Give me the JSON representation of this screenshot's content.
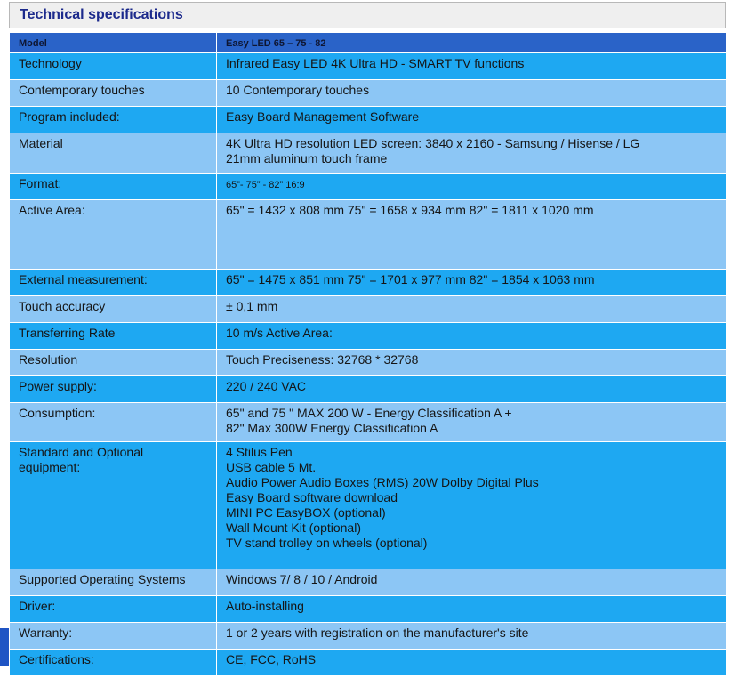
{
  "title": "Technical specifications",
  "header": {
    "label": "Model",
    "value": "Easy LED 65 – 75 - 82"
  },
  "rows": [
    {
      "label": "Technology",
      "value": "Infrared Easy LED 4K Ultra HD - SMART TV functions"
    },
    {
      "label": "Contemporary touches",
      "value": "10 Contemporary touches"
    },
    {
      "label": "Program included:",
      "value": "Easy Board Management Software"
    },
    {
      "label": "Material",
      "value": "4K Ultra HD resolution LED screen: 3840 x 2160 -  Samsung / Hisense / LG\n21mm aluminum touch frame"
    },
    {
      "label": "Format:",
      "value": "65”- 75” - 82”  16:9"
    },
    {
      "label": "Active Area:",
      "value": "65\" = 1432 x 808 mm     75\" = 1658 x 934 mm   82\" = 1811 x 1020 mm"
    },
    {
      "label": "External measurement:",
      "value": "65\" = 1475 x 851 mm     75\" = 1701 x 977 mm   82\" = 1854 x 1063 mm"
    },
    {
      "label": "Touch accuracy",
      "value": "± 0,1 mm"
    },
    {
      "label": "Transferring Rate",
      "value": "10 m/s Active Area:"
    },
    {
      "label": "Resolution",
      "value": "Touch Preciseness: 32768 * 32768"
    },
    {
      "label": "Power supply:",
      "value": "220 / 240 VAC"
    },
    {
      "label": "Consumption:",
      "value": "65\" and 75 \" MAX 200 W - Energy Classification A +\n82\" Max 300W   Energy Classification A"
    },
    {
      "label": "Standard and Optional\nequipment:",
      "value": "4 Stilus Pen\nUSB cable 5 Mt.\nAudio Power Audio Boxes (RMS) 20W Dolby Digital Plus\nEasy Board software download\nMINI PC EasyBOX (optional)\nWall Mount Kit (optional)\nTV stand trolley on wheels (optional)"
    },
    {
      "label": "Supported Operating Systems",
      "value": "Windows 7/  8 / 10 / Android"
    },
    {
      "label": "Driver:",
      "value": "Auto-installing"
    },
    {
      "label": "Warranty:",
      "value": "1 or 2 years with registration on the manufacturer's site"
    },
    {
      "label": "Certifications:",
      "value": "CE, FCC, RoHS"
    }
  ],
  "colors": {
    "header": "#2a63c8",
    "light_row": "#8cc6f5",
    "medium_row": "#1ea8f2",
    "title_text": "#1c2a8c"
  }
}
